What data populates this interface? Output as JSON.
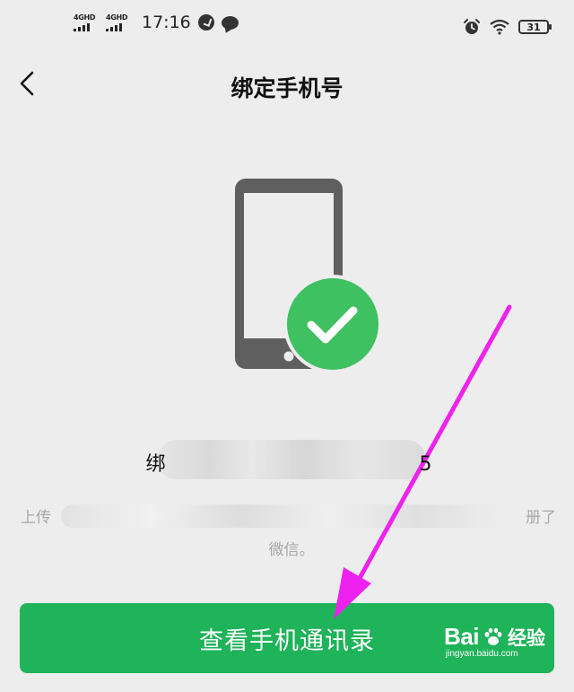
{
  "status_bar": {
    "network_1": "4GHD",
    "network_2": "4GHD",
    "time": "17:16",
    "battery_level": "31",
    "icons": [
      "signal-icon",
      "signal-icon",
      "check-circle-icon",
      "message-bubble-icon",
      "alarm-icon",
      "wifi-icon",
      "battery-icon"
    ]
  },
  "nav": {
    "back_icon": "chevron-left-icon",
    "title": "绑定手机号"
  },
  "illustration": {
    "icon": "phone-check-icon",
    "phone_color": "#5f5f5f",
    "check_color": "#3fc061"
  },
  "bound_number": {
    "prefix": "绑",
    "suffix": "5"
  },
  "upload_desc": {
    "line1_start": "上传",
    "line1_end": "册了",
    "line2": "微信。"
  },
  "primary_button": {
    "label": "查看手机通讯录",
    "color": "#1fb35a"
  },
  "annotation": {
    "arrow_color": "#ee22ee"
  },
  "watermark": {
    "brand": "Bai",
    "brand_suffix": "经验",
    "url": "jingyan.baidu.com"
  }
}
